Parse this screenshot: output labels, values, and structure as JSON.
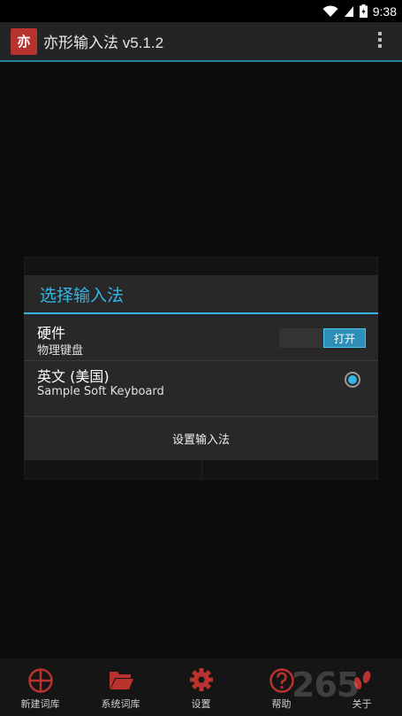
{
  "status_bar": {
    "time": "9:38"
  },
  "action_bar": {
    "app_icon_text": "亦",
    "title": "亦形输入法 v5.1.2"
  },
  "dialog": {
    "title": "选择输入法",
    "items": [
      {
        "title": "硬件",
        "subtitle": "物理键盘",
        "toggle_label": "打开"
      },
      {
        "title": "英文 (美国)",
        "subtitle": "Sample Soft Keyboard",
        "selected": true
      }
    ],
    "setup_button": "设置输入法"
  },
  "bottom_nav": {
    "items": [
      {
        "label": "新建词库",
        "icon": "plus-circle-icon"
      },
      {
        "label": "系统词库",
        "icon": "folder-icon"
      },
      {
        "label": "设置",
        "icon": "gear-icon"
      },
      {
        "label": "帮助",
        "icon": "help-icon"
      },
      {
        "label": "关于",
        "icon": "footprint-icon"
      }
    ]
  },
  "watermark": "265",
  "colors": {
    "accent": "#33b5e5",
    "icon_red": "#b8322e"
  }
}
